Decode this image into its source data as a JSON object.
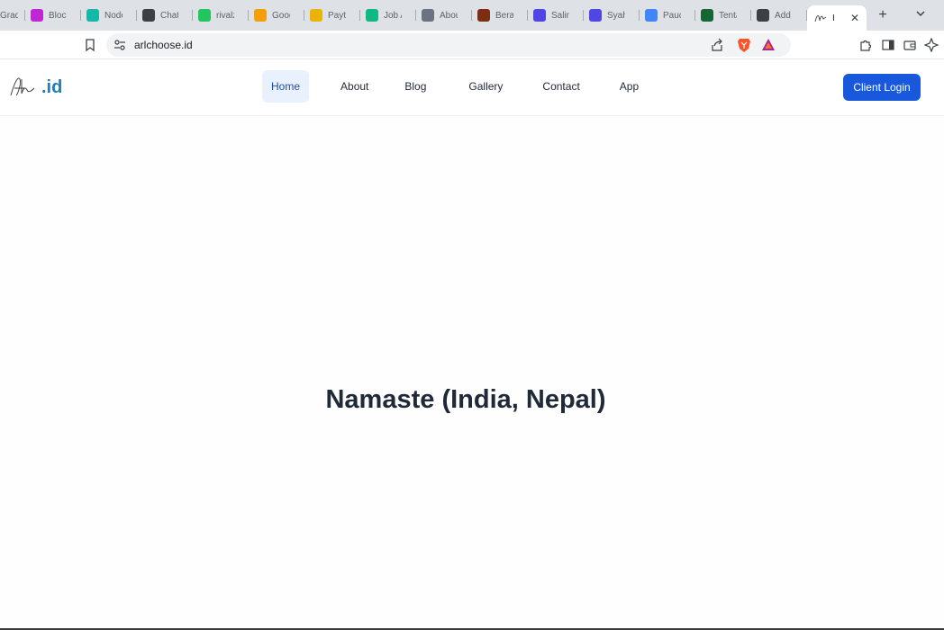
{
  "browser": {
    "tabs": [
      {
        "title": "Gradi",
        "icon": "gradient-icon",
        "color": "#7a5af8"
      },
      {
        "title": "Block",
        "icon": "block-icon",
        "color": "#c026d3"
      },
      {
        "title": "Node",
        "icon": "node-icon",
        "color": "#14b8a6"
      },
      {
        "title": "Chat",
        "icon": "chatgpt-icon",
        "color": "#3c4043"
      },
      {
        "title": "rivalz",
        "icon": "rivalz-icon",
        "color": "#22c55e"
      },
      {
        "title": "Goog",
        "icon": "google-drive-icon",
        "color": "#f59e0b"
      },
      {
        "title": "Paytm",
        "icon": "paytm-icon",
        "color": "#eab308"
      },
      {
        "title": "Job A",
        "icon": "job-icon",
        "color": "#10b981"
      },
      {
        "title": "Abou",
        "icon": "signature-icon",
        "color": "#6b7280"
      },
      {
        "title": "Berat",
        "icon": "berat-icon",
        "color": "#7c2d12"
      },
      {
        "title": "Salin",
        "icon": "salin-icon",
        "color": "#4f46e5"
      },
      {
        "title": "Syah",
        "icon": "syah-icon",
        "color": "#4f46e5"
      },
      {
        "title": "Pauc",
        "icon": "google-icon",
        "color": "#4285f4"
      },
      {
        "title": "Tenta",
        "icon": "tenta-icon",
        "color": "#166534"
      },
      {
        "title": "Add",
        "icon": "add-site-icon",
        "color": "#3c4043"
      }
    ],
    "active_tab": {
      "title": "I",
      "icon": "signature-icon"
    },
    "new_tab_label": "+",
    "url": "arlchoose.id"
  },
  "site": {
    "logo_text": ".id",
    "nav": [
      {
        "label": "Home",
        "active": true
      },
      {
        "label": "About",
        "active": false
      },
      {
        "label": "Blog",
        "active": false
      },
      {
        "label": "Gallery",
        "active": false
      },
      {
        "label": "Contact",
        "active": false
      },
      {
        "label": "App",
        "active": false
      }
    ],
    "login_label": "Client Login",
    "headline": "Namaste (India, Nepal)"
  },
  "colors": {
    "accent": "#1858dc",
    "logo": "#1e7fb8",
    "nav_active_bg": "#e8f1fd",
    "headline": "#1f2937"
  }
}
